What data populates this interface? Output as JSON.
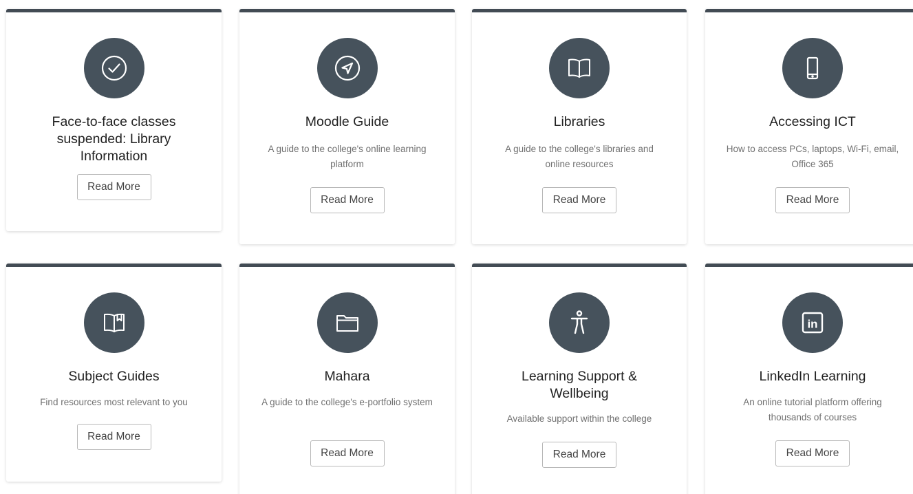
{
  "cards": [
    {
      "title": "Face-to-face classes suspended: Library Information",
      "description": "",
      "button_label": "Read More",
      "icon": "check-circle-icon"
    },
    {
      "title": "Moodle Guide",
      "description": "A guide to the college's online learning platform",
      "button_label": "Read More",
      "icon": "compass-navigation-icon"
    },
    {
      "title": "Libraries",
      "description": "A guide to the college's libraries and online resources",
      "button_label": "Read More",
      "icon": "open-book-icon"
    },
    {
      "title": "Accessing ICT",
      "description": "How to access PCs, laptops, Wi-Fi, email, Office 365",
      "button_label": "Read More",
      "icon": "mobile-phone-icon"
    },
    {
      "title": "Subject Guides",
      "description": "Find resources most relevant to you",
      "button_label": "Read More",
      "icon": "bookmarked-book-icon"
    },
    {
      "title": "Mahara",
      "description": "A guide to the college's e-portfolio system",
      "button_label": "Read More",
      "icon": "folder-icon"
    },
    {
      "title": "Learning Support & Wellbeing",
      "description": "Available support within the college",
      "button_label": "Read More",
      "icon": "accessibility-person-icon"
    },
    {
      "title": "LinkedIn Learning",
      "description": "An online tutorial platform offering thousands of courses",
      "button_label": "Read More",
      "icon": "linkedin-icon"
    }
  ],
  "colors": {
    "card_accent": "#424b54",
    "icon_background": "#46525c",
    "title_text": "#222222",
    "description_text": "#707070"
  }
}
